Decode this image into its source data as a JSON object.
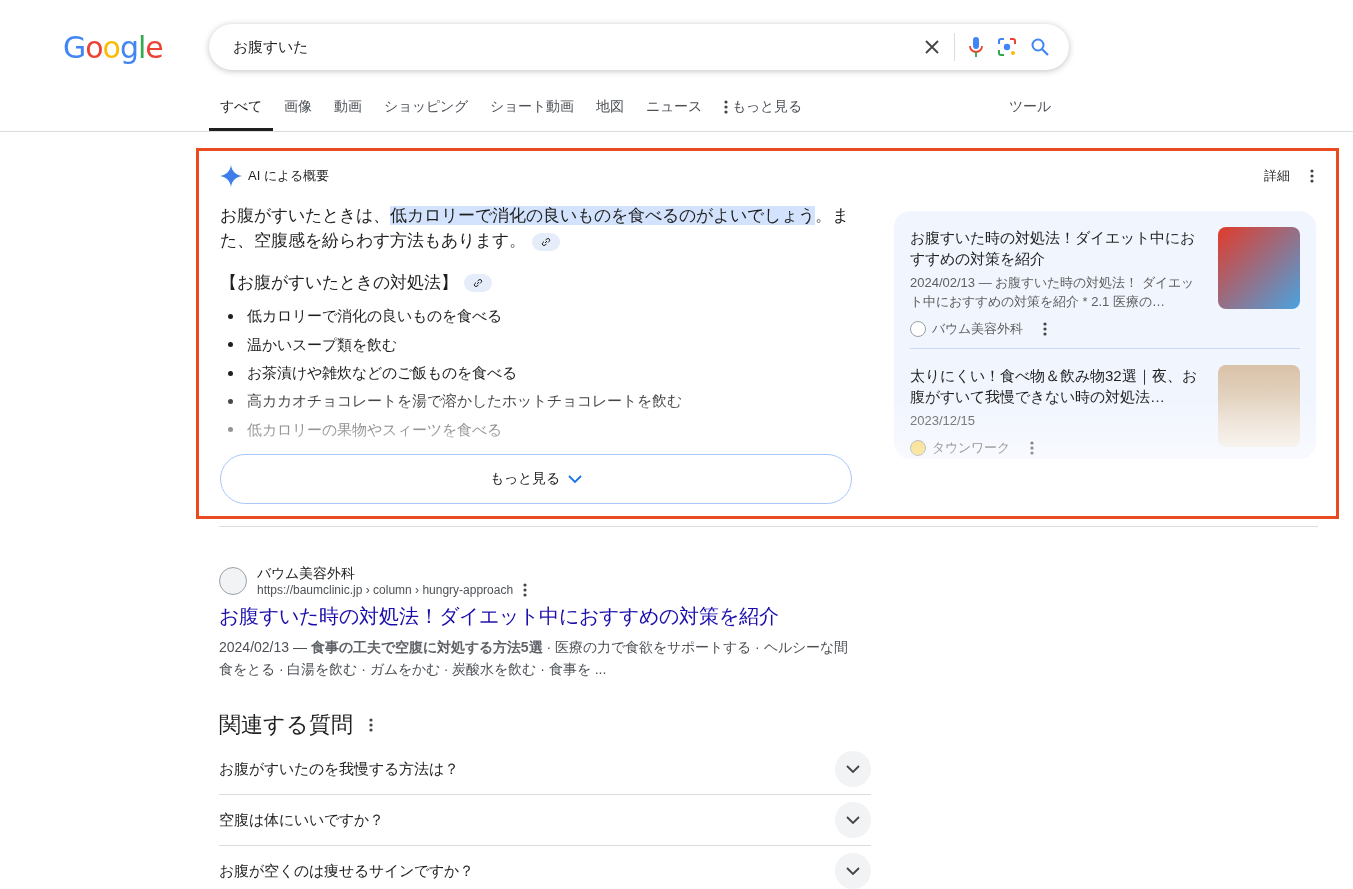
{
  "logo": "Google",
  "search": {
    "value": "お腹すいた"
  },
  "tabs": [
    {
      "label": "すべて",
      "selected": true
    },
    {
      "label": "画像",
      "selected": false
    },
    {
      "label": "動画",
      "selected": false
    },
    {
      "label": "ショッピング",
      "selected": false
    },
    {
      "label": "ショート動画",
      "selected": false
    },
    {
      "label": "地図",
      "selected": false
    },
    {
      "label": "ニュース",
      "selected": false
    },
    {
      "label": "もっと見る",
      "selected": false,
      "kind": "more"
    }
  ],
  "tools": "ツール",
  "ai_overview": {
    "title": "AI による概要",
    "details": "詳細",
    "summary": [
      {
        "text": "お腹がすいたときは、",
        "highlighted": false
      },
      {
        "text": "低カロリーで消化の良いものを食べるのがよいでしょう",
        "highlighted": true
      },
      {
        "text": "。また、空腹感を紛らわす方法もあります。",
        "highlighted": false
      }
    ],
    "heading": "【お腹がすいたときの対処法】",
    "items": [
      "低カロリーで消化の良いものを食べる",
      "温かいスープ類を飲む",
      "お茶漬けや雑炊などのご飯ものを食べる",
      "高カカオチョコレートを湯で溶かしたホットチョコレートを飲む",
      "低カロリーの果物やスィーツを食べる"
    ],
    "more_button": "もっと見る",
    "sources": [
      {
        "title": "お腹すいた時の対処法！ダイエット中におすすめの対策を紹介",
        "snippet": "2024/02/13 — お腹すいた時の対処法！ ダイエット中におすすめの対策を紹介 * 2.1 医療の…",
        "site": "バウム美容外科"
      },
      {
        "title": "太りにくい！食べ物＆飲み物32選｜夜、お腹がすいて我慢できない時の対処法…",
        "snippet": "2023/12/15",
        "site": "タウンワーク"
      }
    ]
  },
  "result": {
    "site": "バウム美容外科",
    "url": "https://baumclinic.jp › column › hungry-approach",
    "title": "お腹すいた時の対処法！ダイエット中におすすめの対策を紹介",
    "snippet": "2024/02/13 — **食事の工夫で空腹に対処する方法5選** · 医療の力で食欲をサポートする · ヘルシーな間食をとる · 白湯を飲む · ガムをかむ · 炭酸水を飲む · 食事を ..."
  },
  "related": {
    "title": "関連する質問",
    "questions": [
      {
        "text": "お腹がすいたのを我慢する方法は？",
        "expanded": false
      },
      {
        "text": "空腹は体にいいですか？",
        "expanded": false
      },
      {
        "text": "お腹が空くのは痩せるサインですか？",
        "expanded": false
      }
    ]
  }
}
